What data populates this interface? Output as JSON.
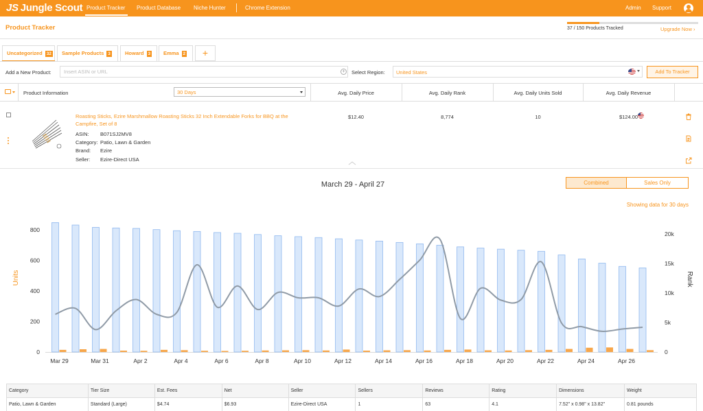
{
  "nav": {
    "logo_initials": "JS",
    "logo_text": "Jungle Scout",
    "links": [
      "Product Tracker",
      "Product Database",
      "Niche Hunter",
      "Chrome Extension"
    ],
    "admin": "Admin",
    "support": "Support"
  },
  "header": {
    "title": "Product Tracker",
    "tracked": "37 / 150 Products Tracked",
    "tracked_fraction": 0.2467,
    "upgrade": "Upgrade Now ›"
  },
  "tabs": [
    {
      "label": "Uncategorized",
      "count": "32"
    },
    {
      "label": "Sample Products",
      "count": "3"
    },
    {
      "label": "Howard",
      "count": "3"
    },
    {
      "label": "Emma",
      "count": "2"
    }
  ],
  "tab_add": "+",
  "add_product": {
    "label": "Add a New Product:",
    "placeholder": "Insert ASIN or URL",
    "region_label": "Select Region:",
    "region_value": "United States",
    "button": "Add To Tracker"
  },
  "columns": {
    "product_info": "Product Information",
    "period": "30 Days",
    "price": "Avg. Daily Price",
    "rank": "Avg. Daily Rank",
    "units": "Avg. Daily Units Sold",
    "revenue": "Avg. Daily Revenue"
  },
  "product": {
    "title": "Roasting Sticks, Ezire Marshmallow Roasting Sticks 32 Inch Extendable Forks for BBQ at the Campfire, Set of 8",
    "asin_label": "ASIN:",
    "asin": "B071SJ2MV8",
    "category_label": "Category:",
    "category": "Patio, Lawn & Garden",
    "brand_label": "Brand:",
    "brand": "Ezire",
    "seller_label": "Seller:",
    "seller": "Ezire-Direct USA",
    "price": "$12.40",
    "rank": "8,774",
    "units": "10",
    "revenue": "$124.00"
  },
  "chart_toggle": {
    "combined": "Combined",
    "sales_only": "Sales Only"
  },
  "chart_data": {
    "type": "bar",
    "title": "March 29 - April 27",
    "subtitle": "Showing data for 30 days",
    "ylabel": "Units",
    "y2label": "Rank",
    "ylim": [
      0,
      850
    ],
    "y2lim": [
      0,
      22000
    ],
    "yticks": [
      "0",
      "200",
      "400",
      "600",
      "800"
    ],
    "y2ticks": [
      "0",
      "5k",
      "10k",
      "15k",
      "20k"
    ],
    "categories": [
      "Mar 29",
      "Mar 30",
      "Mar 31",
      "Apr 1",
      "Apr 2",
      "Apr 3",
      "Apr 4",
      "Apr 5",
      "Apr 6",
      "Apr 7",
      "Apr 8",
      "Apr 9",
      "Apr 10",
      "Apr 11",
      "Apr 12",
      "Apr 13",
      "Apr 14",
      "Apr 15",
      "Apr 16",
      "Apr 17",
      "Apr 18",
      "Apr 19",
      "Apr 20",
      "Apr 21",
      "Apr 22",
      "Apr 23",
      "Apr 24",
      "Apr 25",
      "Apr 26",
      "Apr 27"
    ],
    "xtick_labels": [
      "Mar 29",
      "Mar 31",
      "Apr 2",
      "Apr 4",
      "Apr 6",
      "Apr 8",
      "Apr 10",
      "Apr 12",
      "Apr 14",
      "Apr 16",
      "Apr 18",
      "Apr 20",
      "Apr 22",
      "Apr 24",
      "Apr 26"
    ],
    "series": [
      {
        "values": [
          848,
          832,
          817,
          813,
          810,
          802,
          795,
          790,
          783,
          778,
          770,
          762,
          756,
          750,
          742,
          734,
          727,
          718,
          709,
          700,
          689,
          681,
          674,
          667,
          660,
          636,
          610,
          582,
          561,
          551
        ]
      },
      {
        "values": [
          14,
          18,
          20,
          9,
          8,
          14,
          12,
          8,
          7,
          8,
          10,
          11,
          12,
          10,
          16,
          9,
          11,
          12,
          10,
          14,
          16,
          11,
          10,
          12,
          14,
          20,
          28,
          30,
          20,
          12
        ]
      },
      {
        "values": [
          6400,
          7400,
          3800,
          7000,
          8900,
          6400,
          6700,
          14800,
          7600,
          11200,
          7200,
          10100,
          9200,
          9200,
          7800,
          10700,
          9400,
          12300,
          15600,
          19100,
          5700,
          10800,
          8800,
          8900,
          15300,
          4900,
          4300,
          3500,
          3900,
          4200
        ]
      }
    ],
    "colors": {
      "units": "#d9e8fb",
      "units_border": "#8fb8ef",
      "sales": "#f7a64a",
      "rank": "#8f9aa6"
    }
  },
  "details": {
    "headers": [
      "Category",
      "Tier Size",
      "Est. Fees",
      "Net",
      "Seller",
      "Sellers",
      "Reviews",
      "Rating",
      "Dimensions",
      "Weight"
    ],
    "values": [
      "Patio, Lawn & Garden",
      "Standard (Large)",
      "$4.74",
      "$6.93",
      "Ezire-Direct USA",
      "1",
      "63",
      "4.1",
      "7.52\" x 0.98\" x 13.82\"",
      "0.81 pounds"
    ]
  }
}
